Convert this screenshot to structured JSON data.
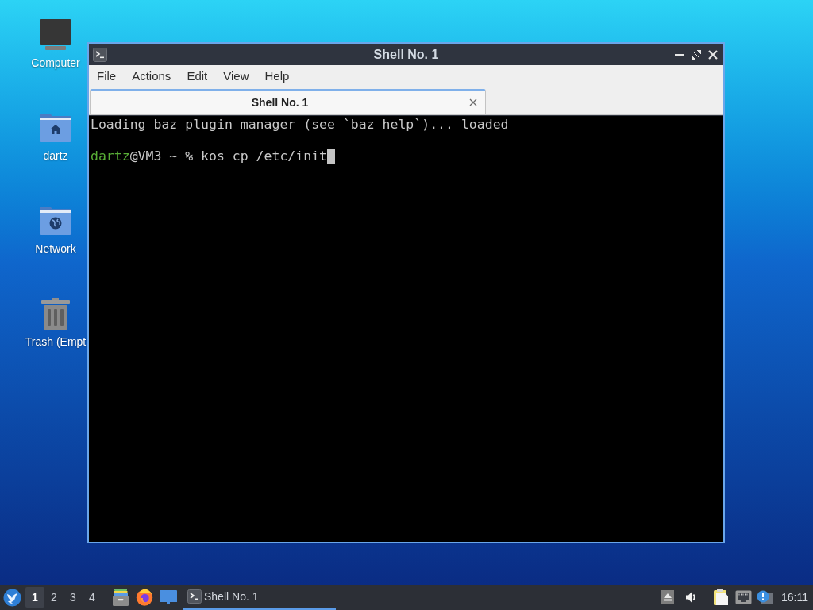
{
  "desktop": {
    "icons": [
      {
        "label": "Computer",
        "kind": "computer"
      },
      {
        "label": "dartz",
        "kind": "home"
      },
      {
        "label": "Network",
        "kind": "network"
      },
      {
        "label": "Trash (Empt",
        "kind": "trash"
      }
    ]
  },
  "window": {
    "title": "Shell No. 1",
    "menu": [
      "File",
      "Actions",
      "Edit",
      "View",
      "Help"
    ],
    "tabs": [
      {
        "label": "Shell No. 1",
        "selected": true
      }
    ],
    "terminal": {
      "output": "Loading baz plugin manager (see `baz help`)... loaded",
      "prompt": {
        "user": "dartz",
        "rest": "@VM3 ~ % kos cp /etc/init"
      },
      "cursor": true
    }
  },
  "taskbar": {
    "workspaces": [
      {
        "label": "1",
        "selected": true
      },
      {
        "label": "2",
        "selected": false
      },
      {
        "label": "3",
        "selected": false
      },
      {
        "label": "4",
        "selected": false
      }
    ],
    "tasks": [
      {
        "label": "Shell No. 1",
        "selected": true
      }
    ],
    "clock": "16:11"
  }
}
